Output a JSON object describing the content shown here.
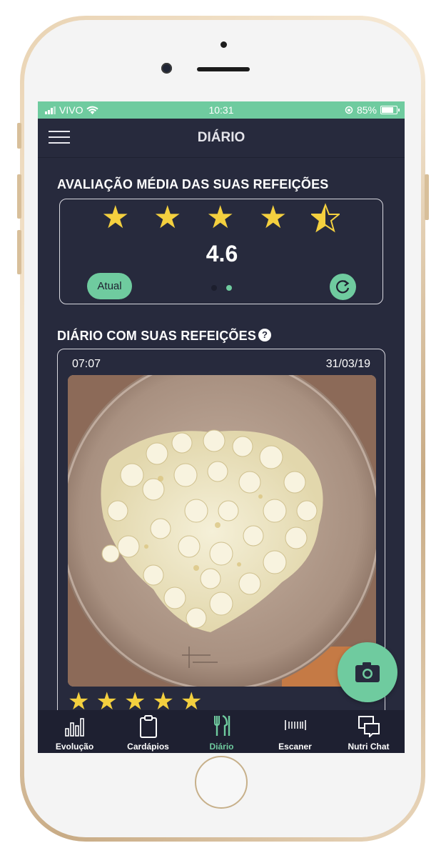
{
  "status_bar": {
    "carrier": "VIVO",
    "time": "10:31",
    "battery": "85%"
  },
  "header": {
    "title": "DIÁRIO"
  },
  "rating": {
    "section_title": "AVALIAÇÃO MÉDIA DAS SUAS REFEIÇÕES",
    "stars": 4.5,
    "average": "4.6",
    "current_label": "Atual",
    "page_index": 2,
    "page_count": 2
  },
  "diary": {
    "section_title": "DIÁRIO COM SUAS REFEIÇÕES",
    "help": "?",
    "entries": [
      {
        "time": "07:07",
        "date": "31/03/19",
        "photo": "popcorn-in-bowl",
        "stars": 5
      }
    ]
  },
  "tabs": [
    {
      "label": "Evolução",
      "icon": "bar-chart-icon",
      "active": false
    },
    {
      "label": "Cardápios",
      "icon": "clipboard-icon",
      "active": false
    },
    {
      "label": "Diário",
      "icon": "cutlery-icon",
      "active": true
    },
    {
      "label": "Escaner",
      "icon": "barcode-icon",
      "active": false
    },
    {
      "label": "Nutri Chat",
      "icon": "chat-icon",
      "active": false
    }
  ],
  "colors": {
    "accent": "#6fcb9f",
    "background": "#272a3d",
    "tabbar": "#1e2031",
    "star": "#f4d03f"
  }
}
